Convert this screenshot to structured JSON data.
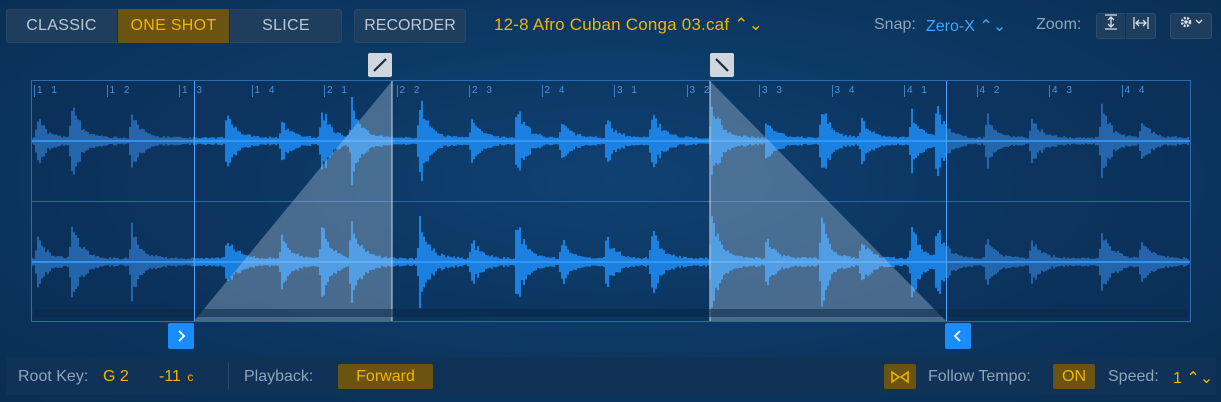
{
  "modes": {
    "items": [
      {
        "label": "CLASSIC",
        "active": false
      },
      {
        "label": "ONE SHOT",
        "active": true
      },
      {
        "label": "SLICE",
        "active": false
      }
    ]
  },
  "recorder": {
    "label": "RECORDER"
  },
  "file": {
    "name": "12-8 Afro Cuban Conga 03.caf ⌃⌄"
  },
  "snap": {
    "label": "Snap:",
    "value": "Zero-X ⌃⌄"
  },
  "zoom": {
    "label": "Zoom:"
  },
  "ruler": [
    "1 1",
    "1 2",
    "1 3",
    "1 4",
    "2 1",
    "2 2",
    "2 3",
    "2 4",
    "3 1",
    "3 2",
    "3 3",
    "3 4",
    "4 1",
    "4 2",
    "4 3",
    "4 4"
  ],
  "bottom": {
    "root_key_label": "Root Key:",
    "root_key_value": "G 2",
    "tune_value": "-11",
    "tune_unit": "c",
    "playback_label": "Playback:",
    "playback_value": "Forward",
    "follow_tempo_label": "Follow Tempo:",
    "follow_tempo_value": "ON",
    "speed_label": "Speed:",
    "speed_value": "1 ⌃⌄"
  },
  "colors": {
    "accent": "#f2b400",
    "blue": "#1a8cff",
    "waveform": "#1e90ff"
  }
}
